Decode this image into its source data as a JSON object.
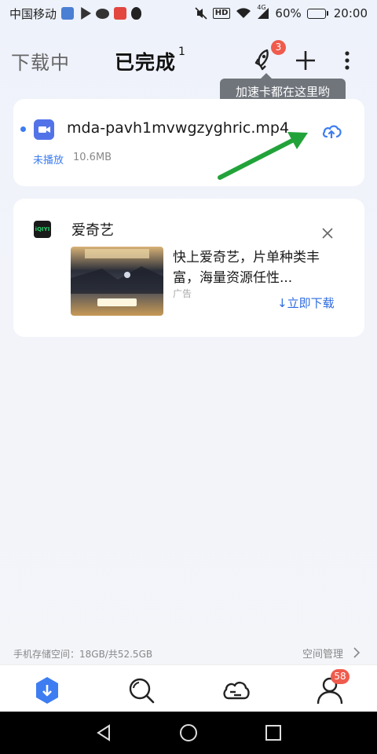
{
  "status_bar": {
    "carrier": "中国移动",
    "battery": "60%",
    "battery_level": 0.6,
    "network": "4G",
    "time": "20:00",
    "hd_label": "HD"
  },
  "header": {
    "tab_downloading": "下载中",
    "tab_completed": "已完成",
    "completed_count": "1",
    "rocket_badge": "3"
  },
  "tooltip": {
    "text": "加速卡都在这里哟"
  },
  "file_item": {
    "name": "mda-pavh1mvwgzyghric.mp4",
    "status": "未播放",
    "size": "10.6MB"
  },
  "ad": {
    "logo_text": "iQIYI",
    "brand": "爱奇艺",
    "headline": "快上爱奇艺，片单种类丰富，海量资源任性...",
    "label": "广告",
    "download": "↓立即下载"
  },
  "storage": {
    "text": "手机存储空间：18GB/共52.5GB",
    "manage": "空间管理"
  },
  "bottom_nav": {
    "profile_badge": "58"
  },
  "colors": {
    "accent": "#3d7df1",
    "badge": "#ef5b4c",
    "arrow": "#22a33a"
  }
}
